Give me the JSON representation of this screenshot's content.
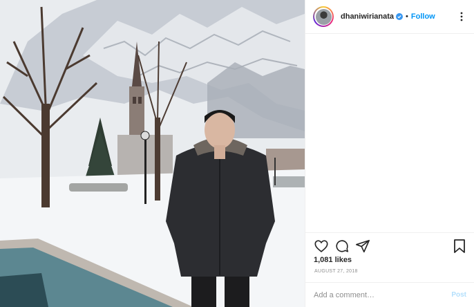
{
  "post": {
    "image_alt": "Man in dark parka standing in snowy park with church spire and mountains",
    "icons": {
      "photo_icon": "photo"
    }
  },
  "header": {
    "username": "dhaniwirianata",
    "verified_icon": "verified-badge-icon",
    "separator": "•",
    "follow_label": "Follow",
    "more_icon": "more-options-icon"
  },
  "actions": {
    "like_icon": "heart-icon",
    "comment_icon": "comment-icon",
    "share_icon": "share-icon",
    "save_icon": "bookmark-icon"
  },
  "likes": {
    "label": "1,081 likes"
  },
  "date": {
    "label": "AUGUST 27, 2018"
  },
  "comment": {
    "placeholder": "Add a comment…",
    "post_label": "Post"
  },
  "colors": {
    "accent": "#0095f6",
    "post_disabled": "#b2dffc",
    "muted": "#8e8e8e",
    "text": "#262626"
  }
}
